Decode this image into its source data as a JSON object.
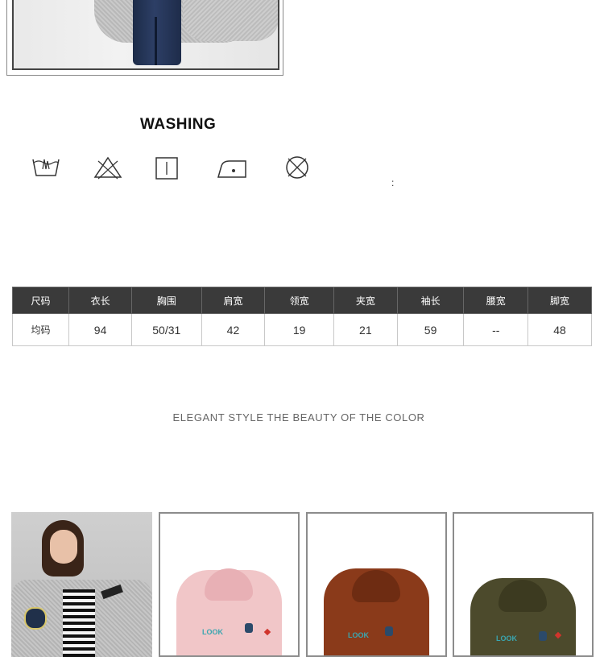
{
  "washing": {
    "title": "WASHING",
    "icons": [
      "hand-wash-icon",
      "no-bleach-icon",
      "tumble-dry-icon",
      "iron-low-icon",
      "no-dry-clean-icon"
    ],
    "colon": ":"
  },
  "size_table": {
    "headers": [
      "尺码",
      "衣长",
      "胸围",
      "肩宽",
      "领宽",
      "夹宽",
      "袖长",
      "腰宽",
      "脚宽"
    ],
    "rows": [
      [
        "均码",
        "94",
        "50/31",
        "42",
        "19",
        "21",
        "59",
        "--",
        "48"
      ]
    ]
  },
  "tagline": "ELEGANT STYLE THE BEAUTY OF THE COLOR",
  "gallery": {
    "patch_text": "LOOK",
    "colors": [
      "#c8c8c8",
      "#f1c6c8",
      "#8a3a1a",
      "#4c4a2c"
    ]
  }
}
